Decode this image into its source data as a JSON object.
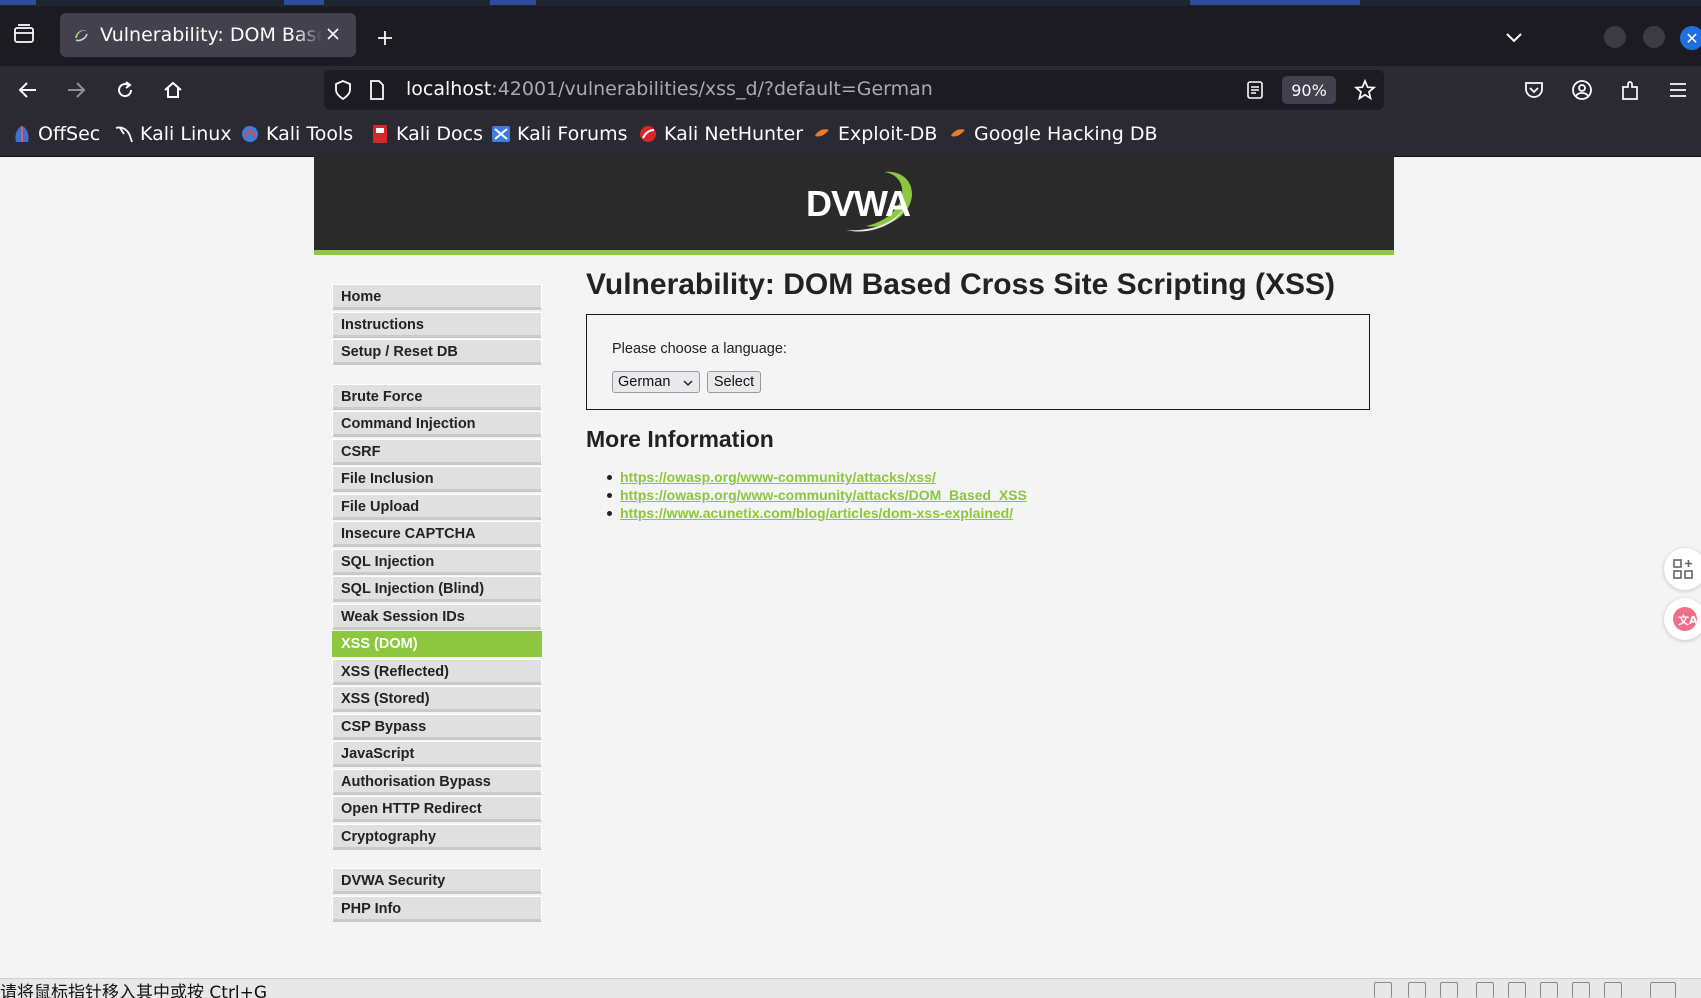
{
  "browser": {
    "tab_title": "Vulnerability: DOM Based Cross Site Scripting (XSS)",
    "url_host": "localhost",
    "url_rest": ":42001/vulnerabilities/xss_d/?default=German",
    "zoom": "90%",
    "bookmarks": [
      {
        "label": "OffSec",
        "icon": "offsec-icon"
      },
      {
        "label": "Kali Linux",
        "icon": "kali-dragon-icon"
      },
      {
        "label": "Kali Tools",
        "icon": "kali-tools-icon"
      },
      {
        "label": "Kali Docs",
        "icon": "kali-docs-icon"
      },
      {
        "label": "Kali Forums",
        "icon": "kali-forums-icon"
      },
      {
        "label": "Kali NetHunter",
        "icon": "nethunter-icon"
      },
      {
        "label": "Exploit-DB",
        "icon": "exploit-db-icon"
      },
      {
        "label": "Google Hacking DB",
        "icon": "ghdb-icon"
      }
    ]
  },
  "site": {
    "logo_text": "DVWA",
    "menu_group1": [
      "Home",
      "Instructions",
      "Setup / Reset DB"
    ],
    "menu_group2": [
      "Brute Force",
      "Command Injection",
      "CSRF",
      "File Inclusion",
      "File Upload",
      "Insecure CAPTCHA",
      "SQL Injection",
      "SQL Injection (Blind)",
      "Weak Session IDs",
      "XSS (DOM)",
      "XSS (Reflected)",
      "XSS (Stored)",
      "CSP Bypass",
      "JavaScript",
      "Authorisation Bypass",
      "Open HTTP Redirect",
      "Cryptography"
    ],
    "menu_group3": [
      "DVWA Security",
      "PHP Info"
    ],
    "active_item": "XSS (DOM)"
  },
  "main": {
    "title": "Vulnerability: DOM Based Cross Site Scripting (XSS)",
    "choose_label": "Please choose a language:",
    "selected_language": "German",
    "select_button": "Select",
    "more_info_title": "More Information",
    "links": [
      "https://owasp.org/www-community/attacks/xss/",
      "https://owasp.org/www-community/attacks/DOM_Based_XSS",
      "https://www.acunetix.com/blog/articles/dom-xss-explained/"
    ]
  },
  "status": {
    "text": "请将鼠标指针移入其中或按 Ctrl+G"
  },
  "colors": {
    "accent": "#8dc63f",
    "header_bg": "#2a2a2a",
    "browser_chrome": "#2b2a33"
  }
}
